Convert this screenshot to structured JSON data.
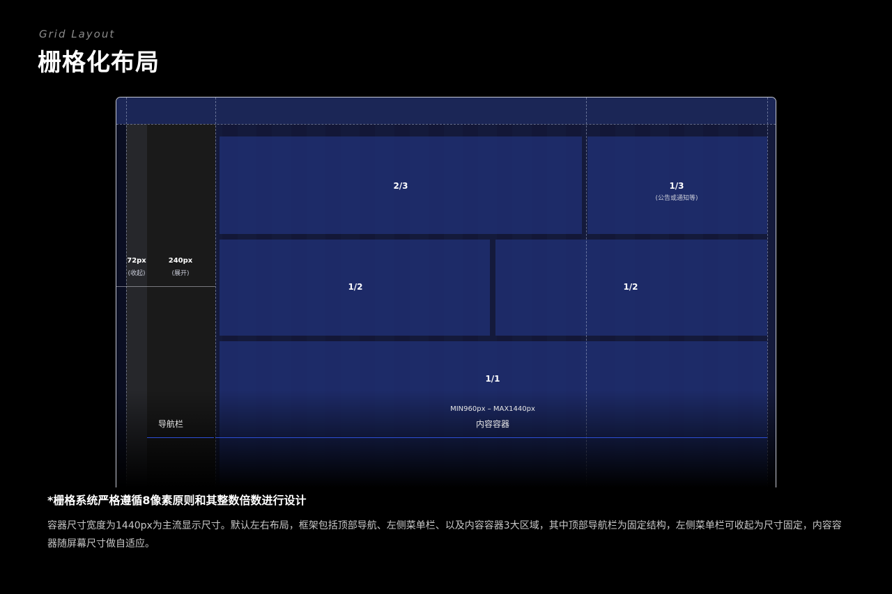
{
  "header": {
    "eyebrow": "Grid Layout",
    "title": "栅格化布局"
  },
  "diagram": {
    "nav": {
      "collapsed_width_label": "72px",
      "collapsed_note": "(收起)",
      "expanded_width_label": "240px",
      "expanded_note": "(展开)",
      "name": "导航栏"
    },
    "blocks": [
      {
        "id": "two-thirds",
        "label": "2/3",
        "note": ""
      },
      {
        "id": "one-third",
        "label": "1/3",
        "note": "(公告或通知等)"
      },
      {
        "id": "half-left",
        "label": "1/2",
        "note": ""
      },
      {
        "id": "half-right",
        "label": "1/2",
        "note": ""
      },
      {
        "id": "full",
        "label": "1/1",
        "note": ""
      }
    ],
    "content": {
      "range": "MIN960px – MAX1440px",
      "name": "内容容器"
    },
    "colors": {
      "topbar": "#1b2656",
      "block": "#1f2d6e",
      "nav_collapsed": "#26272b",
      "nav_expanded": "#1a1a1a",
      "accent": "#2d4fd6"
    }
  },
  "footnote": {
    "title": "*栅格系统严格遵循8像素原则和其整数倍数进行设计",
    "body": "容器尺寸宽度为1440px为主流显示尺寸。默认左右布局，框架包括顶部导航、左侧菜单栏、以及内容容器3大区域，其中顶部导航栏为固定结构，左侧菜单栏可收起为尺寸固定，内容容器随屏幕尺寸做自适应。"
  }
}
